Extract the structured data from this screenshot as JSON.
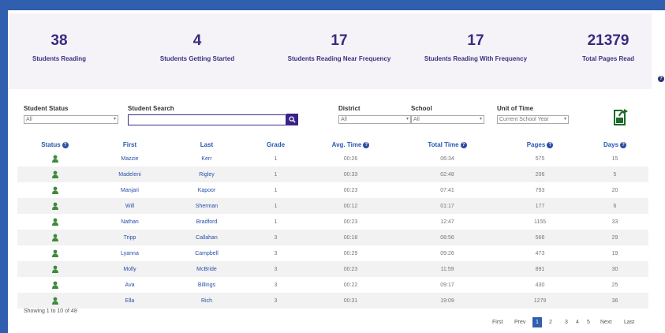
{
  "stats": [
    {
      "value": "38",
      "label": "Students Reading"
    },
    {
      "value": "4",
      "label": "Students Getting Started"
    },
    {
      "value": "17",
      "label": "Students Reading Near Frequency"
    },
    {
      "value": "17",
      "label": "Students Reading With Frequency"
    },
    {
      "value": "21379",
      "label": "Total Pages Read"
    }
  ],
  "filters": {
    "status_label": "Student Status",
    "status_value": "All",
    "search_label": "Student Search",
    "search_value": "",
    "district_label": "District",
    "district_value": "All",
    "school_label": "School",
    "school_value": "All",
    "time_label": "Unit of Time",
    "time_value": "Current School Year"
  },
  "table": {
    "headers": [
      "Status",
      "First",
      "Last",
      "Grade",
      "Avg. Time",
      "Total Time",
      "Pages",
      "Days"
    ],
    "rows": [
      {
        "first": "Mazzie",
        "last": "Kerr",
        "grade": "1",
        "avg": "00:26",
        "total": "06:34",
        "pages": "575",
        "days": "15"
      },
      {
        "first": "Madeleni",
        "last": "Rigley",
        "grade": "1",
        "avg": "00:33",
        "total": "02:48",
        "pages": "206",
        "days": "5"
      },
      {
        "first": "Manjari",
        "last": "Kapoor",
        "grade": "1",
        "avg": "00:23",
        "total": "07:41",
        "pages": "793",
        "days": "20"
      },
      {
        "first": "Will",
        "last": "Sherman",
        "grade": "1",
        "avg": "00:12",
        "total": "01:17",
        "pages": "177",
        "days": "6"
      },
      {
        "first": "Nathan",
        "last": "Bradford",
        "grade": "1",
        "avg": "00:23",
        "total": "12:47",
        "pages": "1155",
        "days": "33"
      },
      {
        "first": "Tripp",
        "last": "Callahan",
        "grade": "3",
        "avg": "00:18",
        "total": "08:56",
        "pages": "566",
        "days": "29"
      },
      {
        "first": "Lyanna",
        "last": "Campbell",
        "grade": "3",
        "avg": "00:29",
        "total": "09:26",
        "pages": "473",
        "days": "19"
      },
      {
        "first": "Molly",
        "last": "McBride",
        "grade": "3",
        "avg": "00:23",
        "total": "11:59",
        "pages": "891",
        "days": "30"
      },
      {
        "first": "Ava",
        "last": "Billings",
        "grade": "3",
        "avg": "00:22",
        "total": "09:17",
        "pages": "430",
        "days": "25"
      },
      {
        "first": "Ella",
        "last": "Rich",
        "grade": "3",
        "avg": "00:31",
        "total": "19:09",
        "pages": "1279",
        "days": "36"
      }
    ]
  },
  "footer": {
    "showing": "Showing 1 to 10 of 48",
    "first": "First",
    "prev": "Prev",
    "pages": [
      "1",
      "2",
      "3",
      "4",
      "5"
    ],
    "next": "Next",
    "last": "Last"
  },
  "icons": {
    "help": "question-circle-icon",
    "status": "user-icon",
    "search": "search-icon",
    "export": "export-file-icon"
  },
  "colors": {
    "brand": "#2f5fae",
    "accent": "#3a2288",
    "stat_text": "#3a2a80",
    "link": "#2a4ea8",
    "status_green": "#3d8a3d"
  }
}
